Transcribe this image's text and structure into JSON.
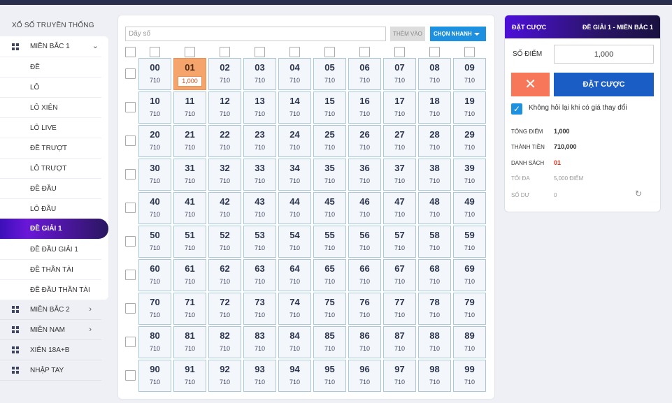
{
  "sidebar": {
    "heading": "XỔ SỐ TRUYỀN THỐNG",
    "open_category": "MIỀN BẮC 1",
    "sub_items": [
      "ĐỀ",
      "LÔ",
      "LÔ XIÊN",
      "LÔ LIVE",
      "ĐỀ TRƯỢT",
      "LÔ TRƯỢT",
      "ĐỀ ĐẦU",
      "LÔ ĐẦU",
      "ĐỀ GIẢI 1",
      "ĐỀ ĐẦU GIẢI 1",
      "ĐỀ THẦN TÀI",
      "ĐỀ ĐẦU THẦN TÀI"
    ],
    "active_sub": "ĐỀ GIẢI 1",
    "other_categories": [
      "MIỀN BẮC 2",
      "MIỀN NAM",
      "XIÊN 18A+B",
      "NHẬP TAY"
    ]
  },
  "toolbar": {
    "dayso_placeholder": "Dãy số",
    "them_vao": "THÊM VÀO",
    "chon_nhanh": "CHỌN NHANH"
  },
  "grid": {
    "price": "710",
    "selected": "01",
    "selected_points": "1,000"
  },
  "bet": {
    "title": "ĐẶT CƯỢC",
    "subtitle": "ĐỀ GIẢI 1 - MIỀN BẮC 1",
    "so_diem_label": "SỐ ĐIỂM",
    "so_diem_value": "1,000",
    "cancel_symbol": "✕",
    "dat_cuoc": "ĐẶT CƯỢC",
    "confirm_label": "Không hỏi lại khi có giá thay đổi",
    "tong_diem_label": "TỔNG ĐIỂM",
    "tong_diem": "1,000",
    "thanh_tien_label": "THÀNH TIỀN",
    "thanh_tien": "710,000",
    "danh_sach_label": "DANH SÁCH",
    "danh_sach": "01",
    "toi_da_label": "TỐI ĐA",
    "toi_da": "5,000 ĐIỂM",
    "so_du_label": "SỐ DƯ",
    "so_du": "0"
  },
  "colors": {
    "accent_blue": "#1e90e0",
    "selected_cell": "#f5a46c",
    "danh_sach_red": "#e0301e"
  },
  "icons": {
    "menu": "grid-icon",
    "expand": "chevron-down-icon",
    "collapsed": "chevron-right-icon",
    "refresh": "refresh-icon",
    "check": "check-icon",
    "cancel": "close-icon"
  }
}
